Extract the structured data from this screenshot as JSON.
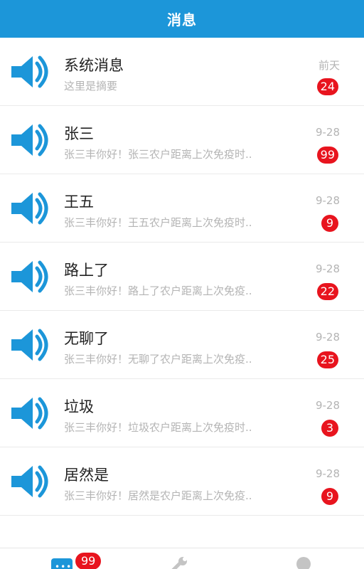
{
  "header": {
    "title": "消息"
  },
  "messages": [
    {
      "title": "系统消息",
      "preview": "这里是摘要",
      "time": "前天",
      "badge": "24"
    },
    {
      "title": "张三",
      "preview": "张三丰你好！张三农户距离上次免疫时..",
      "time": "9-28",
      "badge": "99"
    },
    {
      "title": "王五",
      "preview": "张三丰你好！王五农户距离上次免疫时..",
      "time": "9-28",
      "badge": "9"
    },
    {
      "title": "路上了",
      "preview": "张三丰你好！路上了农户距离上次免疫..",
      "time": "9-28",
      "badge": "22"
    },
    {
      "title": "无聊了",
      "preview": "张三丰你好！无聊了农户距离上次免疫..",
      "time": "9-28",
      "badge": "25"
    },
    {
      "title": "垃圾",
      "preview": "张三丰你好！垃圾农户距离上次免疫时..",
      "time": "9-28",
      "badge": "3"
    },
    {
      "title": "居然是",
      "preview": "张三丰你好！居然是农户距离上次免疫..",
      "time": "9-28",
      "badge": "9"
    }
  ],
  "tabbar": {
    "messages_badge": "99",
    "messages_icon": "chat-bubble-icon",
    "tools_icon": "wrench-icon",
    "me_icon": "person-icon"
  },
  "colors": {
    "primary": "#1c96d9",
    "badge": "#e8141e",
    "muted_text": "#b4b4b4"
  },
  "icons": {
    "message_row": "speaker-icon"
  }
}
